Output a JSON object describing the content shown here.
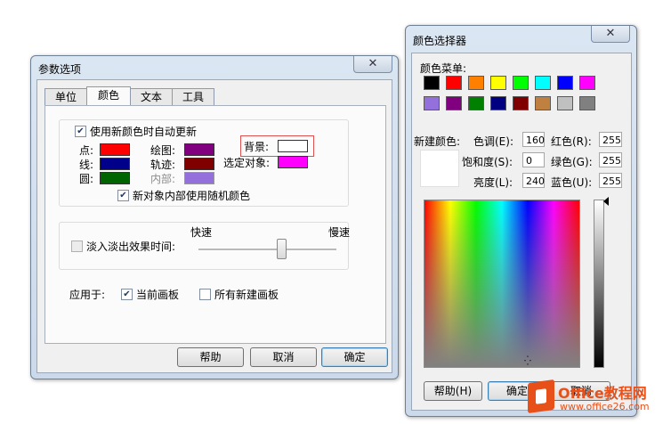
{
  "options_dialog": {
    "title": "参数选项",
    "close_glyph": "✕",
    "tabs": [
      {
        "label": "单位"
      },
      {
        "label": "颜色"
      },
      {
        "label": "文本"
      },
      {
        "label": "工具"
      }
    ],
    "auto_update": {
      "label": "使用新颜色时自动更新",
      "checked": true
    },
    "colors": {
      "point": {
        "label": "点:",
        "color": "#ff0000"
      },
      "line": {
        "label": "线:",
        "color": "#00008b"
      },
      "circle": {
        "label": "圆:",
        "color": "#006400"
      },
      "plot": {
        "label": "绘图:",
        "color": "#800080"
      },
      "trace": {
        "label": "轨迹:",
        "color": "#800000"
      },
      "interior": {
        "label": "内部:",
        "color": "#9370db"
      },
      "background": {
        "label": "背景:",
        "color": "#ffffff"
      },
      "selection": {
        "label": "选定对象:",
        "color": "#ff00ff"
      }
    },
    "random_interior": {
      "label": "新对象内部使用随机颜色",
      "checked": true
    },
    "fade": {
      "label": "淡入淡出效果时间:",
      "checked": false,
      "fast_label": "快速",
      "slow_label": "慢速",
      "level_fraction": 0.6
    },
    "apply_label": "应用于:",
    "apply_current": {
      "label": "当前画板",
      "checked": true
    },
    "apply_all_new": {
      "label": "所有新建画板",
      "checked": false
    },
    "buttons": {
      "help": "帮助",
      "cancel": "取消",
      "ok": "确定"
    }
  },
  "color_picker": {
    "title": "颜色选择器",
    "close_glyph": "✕",
    "menu_label": "颜色菜单:",
    "swatches_row1": [
      "#000000",
      "#ff0000",
      "#ff8000",
      "#ffff00",
      "#00ff00",
      "#00ffff",
      "#0000ff",
      "#ff00ff"
    ],
    "swatches_row2": [
      "#9370db",
      "#800080",
      "#008000",
      "#000080",
      "#800000",
      "#c08040",
      "#c0c0c0",
      "#808080"
    ],
    "new_color_label": "新建颜色:",
    "new_color_preview": "#ffffff",
    "hue": {
      "label": "色调(E):",
      "value": "160"
    },
    "saturation": {
      "label": "饱和度(S):",
      "value": "0"
    },
    "luminance": {
      "label": "亮度(L):",
      "value": "240"
    },
    "red": {
      "label": "红色(R):",
      "value": "255"
    },
    "green": {
      "label": "绿色(G):",
      "value": "255"
    },
    "blue": {
      "label": "蓝色(U):",
      "value": "255"
    },
    "buttons": {
      "help": "帮助(H)",
      "ok": "确定",
      "cancel": "取消"
    }
  },
  "watermark": {
    "brand": "Office教程网",
    "url": "www.office26.com"
  }
}
